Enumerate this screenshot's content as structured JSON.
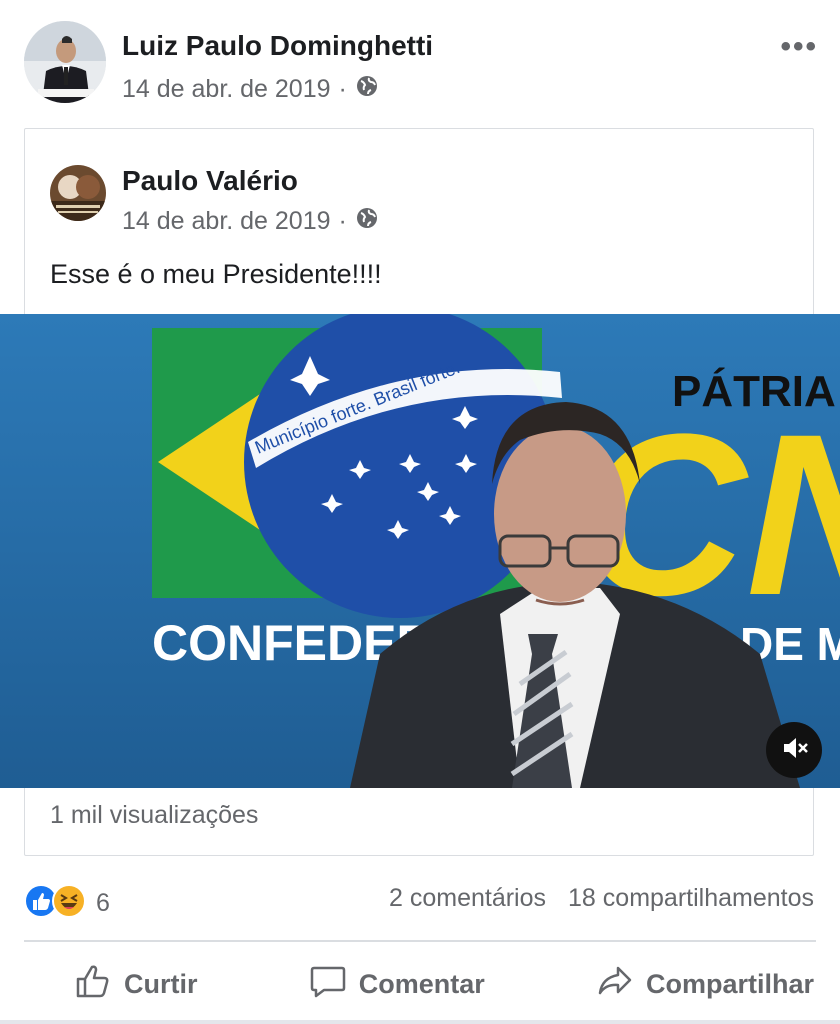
{
  "post": {
    "author_name": "Luiz Paulo Dominghetti",
    "date": "14 de abr. de 2019",
    "separator": "·",
    "more_label": "•••"
  },
  "shared_post": {
    "author_name": "Paulo Valério",
    "date": "14 de abr. de 2019",
    "separator": "·",
    "text": "Esse é o meu Presidente!!!!",
    "views": "1 mil visualizações"
  },
  "video": {
    "banner_text": "Município forte. Brasil forte.",
    "bottom_text": "CONFEDER",
    "bottom_text_right": "DE M",
    "logo_text": "PÁTRIA",
    "cnm_text": "CN"
  },
  "reactions": {
    "count": "6",
    "types": [
      "like",
      "haha"
    ]
  },
  "stats": {
    "comments": "2 comentários",
    "shares": "18 compartilhamentos"
  },
  "actions": {
    "like": "Curtir",
    "comment": "Comentar",
    "share": "Compartilhar"
  },
  "colors": {
    "like_blue": "#1877f2",
    "haha_yellow": "#f7b125",
    "secondary_text": "#65676b"
  }
}
